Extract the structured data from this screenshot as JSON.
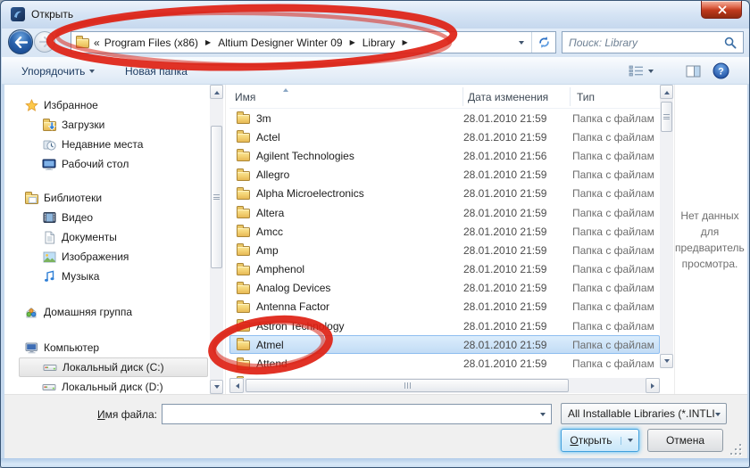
{
  "window": {
    "title": "Открыть"
  },
  "nav": {
    "breadcrumb": {
      "prefix": "«",
      "segments": [
        "Program Files (x86)",
        "Altium Designer Winter 09",
        "Library"
      ]
    },
    "search_placeholder": "Поиск: Library"
  },
  "toolbar": {
    "organize_label": "Упорядочить",
    "new_folder_label": "Новая папка"
  },
  "sidebar": {
    "groups": [
      {
        "label": "Избранное",
        "icon": "star-icon",
        "items": [
          {
            "label": "Загрузки",
            "icon": "downloads-folder-icon"
          },
          {
            "label": "Недавние места",
            "icon": "recent-places-icon"
          },
          {
            "label": "Рабочий стол",
            "icon": "desktop-icon"
          }
        ]
      },
      {
        "label": "Библиотеки",
        "icon": "libraries-icon",
        "items": [
          {
            "label": "Видео",
            "icon": "video-icon"
          },
          {
            "label": "Документы",
            "icon": "documents-icon"
          },
          {
            "label": "Изображения",
            "icon": "pictures-icon"
          },
          {
            "label": "Музыка",
            "icon": "music-icon"
          }
        ]
      },
      {
        "label": "Домашняя группа",
        "icon": "homegroup-icon",
        "items": []
      },
      {
        "label": "Компьютер",
        "icon": "computer-icon",
        "items": [
          {
            "label": "Локальный диск (C:)",
            "icon": "disk-icon",
            "selected": true
          },
          {
            "label": "Локальный диск (D:)",
            "icon": "disk-icon"
          }
        ]
      }
    ]
  },
  "list": {
    "columns": [
      "Имя",
      "Дата изменения",
      "Тип"
    ],
    "row_icon": "folder-icon",
    "rows": [
      {
        "name": "3m",
        "date": "28.01.2010 21:59",
        "type": "Папка с файлами"
      },
      {
        "name": "Actel",
        "date": "28.01.2010 21:59",
        "type": "Папка с файлами"
      },
      {
        "name": "Agilent Technologies",
        "date": "28.01.2010 21:56",
        "type": "Папка с файлами"
      },
      {
        "name": "Allegro",
        "date": "28.01.2010 21:59",
        "type": "Папка с файлами"
      },
      {
        "name": "Alpha Microelectronics",
        "date": "28.01.2010 21:59",
        "type": "Папка с файлами"
      },
      {
        "name": "Altera",
        "date": "28.01.2010 21:59",
        "type": "Папка с файлами"
      },
      {
        "name": "Amcc",
        "date": "28.01.2010 21:59",
        "type": "Папка с файлами"
      },
      {
        "name": "Amp",
        "date": "28.01.2010 21:59",
        "type": "Папка с файлами"
      },
      {
        "name": "Amphenol",
        "date": "28.01.2010 21:59",
        "type": "Папка с файлами"
      },
      {
        "name": "Analog Devices",
        "date": "28.01.2010 21:59",
        "type": "Папка с файлами"
      },
      {
        "name": "Antenna Factor",
        "date": "28.01.2010 21:59",
        "type": "Папка с файлами"
      },
      {
        "name": "Astron Technology",
        "date": "28.01.2010 21:59",
        "type": "Папка с файлами"
      },
      {
        "name": "Atmel",
        "date": "28.01.2010 21:59",
        "type": "Папка с файлами",
        "selected": true
      },
      {
        "name": "Attend",
        "date": "28.01.2010 21:59",
        "type": "Папка с файлами"
      },
      {
        "name": "",
        "date": "",
        "type": "",
        "partial": true
      }
    ]
  },
  "preview": {
    "message": "Нет данных для предварительного просмотра."
  },
  "footer": {
    "filename_label": "Имя файла:",
    "filename_value": "",
    "filetype_value": "All Installable Libraries (*.INTLIB",
    "open_label": "Открыть",
    "cancel_label": "Отмена"
  },
  "annotations": {
    "color": "#de2114",
    "circled": [
      "address-bar-path",
      "atmel-row"
    ]
  }
}
